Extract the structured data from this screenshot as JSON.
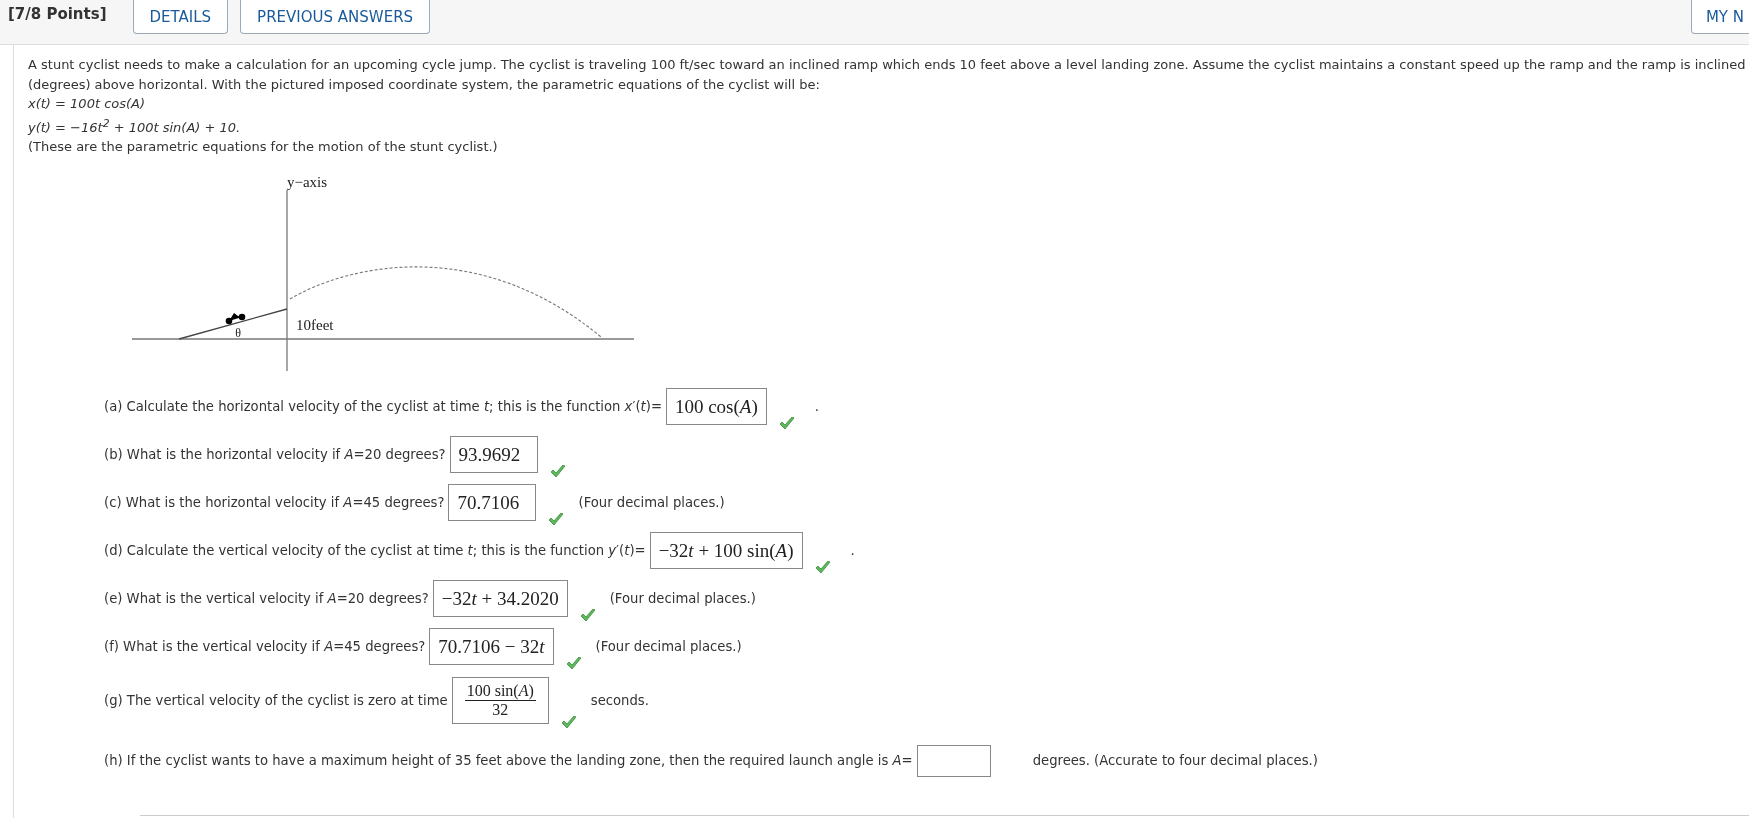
{
  "header": {
    "score": "[7/8 Points]",
    "buttons": [
      "DETAILS",
      "PREVIOUS ANSWERS",
      "MY N"
    ]
  },
  "problem": {
    "lines": [
      {
        "kind": "text",
        "text": "A stunt cyclist needs to make a calculation for an upcoming cycle jump. The cyclist is traveling 100 ft/sec toward an inclined ramp which ends 10 feet above a level landing zone. Assume the cyclist maintains a constant speed up the ramp and the ramp is inclined"
      },
      {
        "kind": "text",
        "text": "(degrees) above horizontal. With the pictured imposed coordinate system, the parametric equations of the cyclist will be:"
      },
      {
        "kind": "formula",
        "text": "x(t) = 100t cos(A)"
      },
      {
        "kind": "formula",
        "text": "y(t) = −16t$^{2}$ + 100t sin(A) + 10."
      },
      {
        "kind": "text",
        "text": "(These are the parametric equations for the motion of the stunt cyclist.)"
      }
    ]
  },
  "diagram": {
    "axis_label": "y−axis",
    "height_label": "10feet",
    "angle_label": "θ"
  },
  "questions": [
    {
      "label": "(a) Calculate the horizontal velocity of the cyclist at time *t*; this is the function *x*′(*t*)=",
      "answer": {
        "kind": "text",
        "value": "100 cos(*A*)"
      },
      "correct": true,
      "after": "."
    },
    {
      "label": "(b) What is the horizontal velocity if *A*=20 degrees?",
      "answer": {
        "kind": "text",
        "value": "93.9692"
      },
      "correct": true
    },
    {
      "label": "(c) What is the horizontal velocity if *A*=45 degrees?",
      "answer": {
        "kind": "text",
        "value": "70.7106"
      },
      "correct": true,
      "after": "(Four decimal places.)"
    },
    {
      "label": "(d) Calculate the vertical velocity of the cyclist at time *t*; this is the function *y*′(*t*)=",
      "answer": {
        "kind": "parts",
        "parts": [
          {
            "kind": "number",
            "text": "−32"
          },
          {
            "kind": "variable",
            "text": "t"
          },
          {
            "kind": "number",
            "text": " + 100 sin("
          },
          {
            "kind": "variable",
            "text": "A"
          },
          {
            "kind": "number",
            "text": ")"
          }
        ]
      },
      "correct": true,
      "after": "."
    },
    {
      "label": "(e) What is the vertical velocity if *A*=20 degrees?",
      "answer": {
        "kind": "parts",
        "parts": [
          {
            "kind": "number",
            "text": "−32"
          },
          {
            "kind": "variable",
            "text": "t"
          },
          {
            "kind": "number",
            "text": " + 34.2020"
          }
        ]
      },
      "correct": true,
      "after": "(Four decimal places.)"
    },
    {
      "label": "(f) What is the vertical velocity if *A*=45 degrees?",
      "answer": {
        "kind": "parts",
        "parts": [
          {
            "kind": "number",
            "text": "70.7106 − 32"
          },
          {
            "kind": "variable",
            "text": "t"
          }
        ]
      },
      "correct": true,
      "after": "(Four decimal places.)"
    },
    {
      "label": "(g) The vertical velocity of the cyclist is zero at time",
      "answer": {
        "kind": "fraction",
        "numerator": "100 sin(*A*)",
        "denominator": "32"
      },
      "correct": true,
      "after": "seconds."
    },
    {
      "label": "(h) If the cyclist wants to have a maximum height of 35 feet above the landing zone, then the required launch angle is *A*=",
      "answer": {
        "kind": "empty"
      },
      "correct": false,
      "after": "degrees. (Accurate to four decimal places.)"
    }
  ]
}
